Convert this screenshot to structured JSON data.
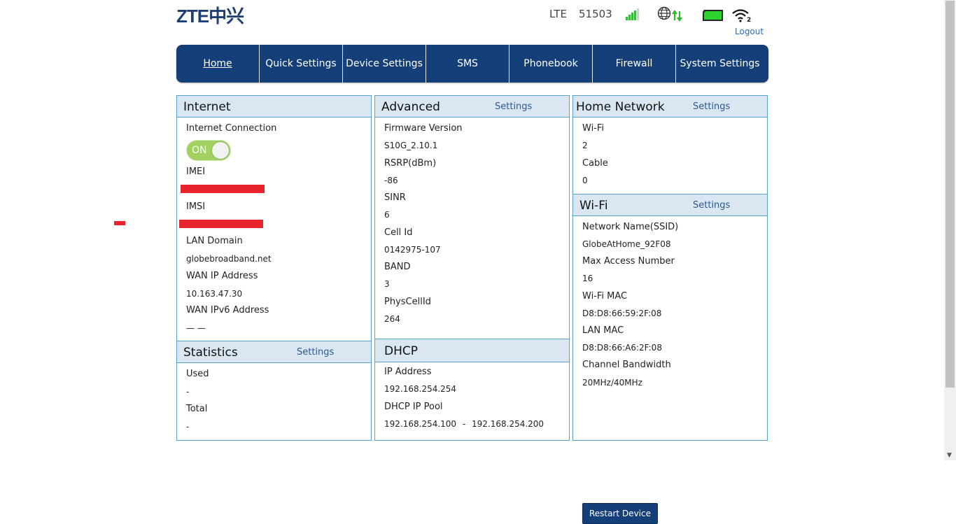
{
  "header": {
    "logo": "ZTE中兴",
    "network_type": "LTE",
    "operator": "51503",
    "wifi_clients": "2",
    "logout": "Logout"
  },
  "nav": {
    "items": [
      {
        "label": "Home",
        "active": true
      },
      {
        "label": "Quick Settings"
      },
      {
        "label": "Device Settings"
      },
      {
        "label": "SMS"
      },
      {
        "label": "Phonebook"
      },
      {
        "label": "Firewall"
      },
      {
        "label": "System Settings"
      }
    ]
  },
  "internet": {
    "title": "Internet",
    "connection_label": "Internet Connection",
    "toggle_label": "ON",
    "imei_label": "IMEI",
    "imsi_label": "IMSI",
    "lan_domain_label": "LAN Domain",
    "lan_domain": "globebroadband.net",
    "wan_ip_label": "WAN IP Address",
    "wan_ip": "10.163.47.30",
    "wan_ipv6_label": "WAN IPv6 Address",
    "wan_ipv6": "— —"
  },
  "statistics": {
    "title": "Statistics",
    "settings": "Settings",
    "used_label": "Used",
    "used": "-",
    "total_label": "Total",
    "total": "-"
  },
  "advanced": {
    "title": "Advanced",
    "settings": "Settings",
    "firmware_label": "Firmware Version",
    "firmware": "S10G_2.10.1",
    "rsrp_label": "RSRP(dBm)",
    "rsrp": "-86",
    "sinr_label": "SINR",
    "sinr": "6",
    "cellid_label": "Cell Id",
    "cellid": "0142975-107",
    "band_label": "BAND",
    "band": "3",
    "physcellid_label": "PhysCellId",
    "physcellid": "264"
  },
  "dhcp": {
    "title": "DHCP",
    "ip_label": "IP Address",
    "ip": "192.168.254.254",
    "pool_label": "DHCP IP Pool",
    "pool_start": "192.168.254.100",
    "pool_sep": "-",
    "pool_end": "192.168.254.200"
  },
  "home_network": {
    "title": "Home Network",
    "settings": "Settings",
    "wifi_label": "Wi-Fi",
    "wifi_count": "2",
    "cable_label": "Cable",
    "cable_count": "0"
  },
  "wifi": {
    "title": "Wi-Fi",
    "settings": "Settings",
    "ssid_label": "Network Name(SSID)",
    "ssid": "GlobeAtHome_92F08",
    "max_label": "Max Access Number",
    "max": "16",
    "mac_label": "Wi-Fi MAC",
    "mac": "D8:D8:66:59:2F:08",
    "lan_mac_label": "LAN MAC",
    "lan_mac": "D8:D8:66:A6:2F:08",
    "bw_label": "Channel Bandwidth",
    "bw": "20MHz/40MHz",
    "restart": "Restart Device"
  },
  "colors": {
    "nav_bg": "#153f79",
    "panel_border": "#5aa3cf",
    "panel_header": "#dbe6f3",
    "toggle_on": "#a2d162",
    "redaction": "#e8232b",
    "signal": "#3cb83c",
    "battery": "#2ed22e"
  },
  "icons": {
    "signal": "signal-bars-icon",
    "globe": "globe-data-icon",
    "battery": "battery-icon",
    "wifi": "wifi-icon"
  }
}
